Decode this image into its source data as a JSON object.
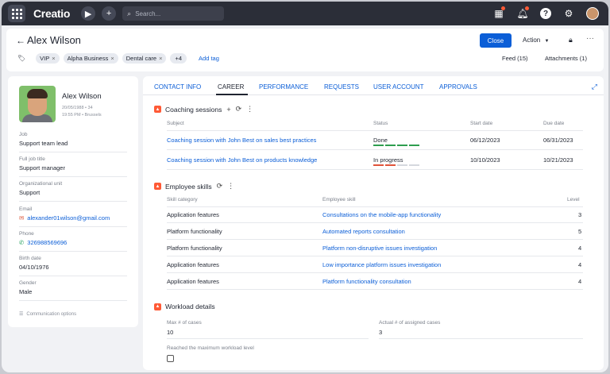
{
  "topbar": {
    "logo": "Creatio",
    "search_placeholder": "Search...",
    "icons": [
      "apps-grid-icon",
      "play-icon",
      "plus-icon",
      "search-icon",
      "shortcuts-icon",
      "bell-icon",
      "help-icon",
      "settings-icon",
      "avatar"
    ]
  },
  "header": {
    "title": "Alex Wilson",
    "close_label": "Close",
    "action_label": "Action",
    "tags": [
      "VIP",
      "Alpha Business",
      "Dental care"
    ],
    "more_tags": "+4",
    "add_tag": "Add tag",
    "feed": "Feed (15)",
    "attachments": "Attachments (1)"
  },
  "profile": {
    "name": "Alex Wilson",
    "birth_meta": "20/05/1988 • 34",
    "time_meta": "19:55 PM • Brussels",
    "fields": [
      {
        "label": "Job",
        "value": "Support team lead"
      },
      {
        "label": "Full job title",
        "value": "Support manager"
      },
      {
        "label": "Organizational unit",
        "value": "Support"
      },
      {
        "label": "Email",
        "value": "alexander01wilson@gmail.com"
      },
      {
        "label": "Phone",
        "value": "326988569696"
      },
      {
        "label": "Birth date",
        "value": "04/10/1976"
      },
      {
        "label": "Gender",
        "value": "Male"
      }
    ],
    "communication_options": "Communication options"
  },
  "tabs": [
    "CONTACT INFO",
    "CAREER",
    "PERFORMANCE",
    "REQUESTS",
    "USER ACCOUNT",
    "APPROVALS"
  ],
  "active_tab": "CAREER",
  "coaching": {
    "title": "Coaching sessions",
    "headers": {
      "subject": "Subject",
      "status": "Status",
      "start": "Start date",
      "due": "Due date"
    },
    "rows": [
      {
        "subject": "Coaching session with John Best on sales best practices",
        "status": "Done",
        "start": "06/12/2023",
        "due": "06/31/2023",
        "progress": 1.0
      },
      {
        "subject": "Coaching session with John Best on products knowledge",
        "status": "In progress",
        "start": "10/10/2023",
        "due": "10/21/2023",
        "progress": 0.5
      }
    ]
  },
  "skills": {
    "title": "Employee skills",
    "headers": {
      "category": "Skill category",
      "skill": "Employee skill",
      "level": "Level"
    },
    "rows": [
      {
        "category": "Application features",
        "skill": "Consultations on the mobile-app functionality",
        "level": "3"
      },
      {
        "category": "Platform functionality",
        "skill": "Automated reports consultation",
        "level": "5"
      },
      {
        "category": "Platform functionality",
        "skill": "Platform non-disruptive issues investigation",
        "level": "4"
      },
      {
        "category": "Application features",
        "skill": "Low importance platform issues investigation",
        "level": "4"
      },
      {
        "category": "Application features",
        "skill": "Platform functionality consultation",
        "level": "4"
      }
    ]
  },
  "workload": {
    "title": "Workload details",
    "max_label": "Max # of cases",
    "max_value": "10",
    "actual_label": "Actual # of assigned cases",
    "actual_value": "3",
    "reached_label": "Reached the maximum workload level",
    "reached_checked": false
  },
  "colors": {
    "accent": "#0b5ed7",
    "brand_orange": "#ff5a36",
    "done": "#2e9e4f",
    "in_progress": "#e0533a"
  }
}
